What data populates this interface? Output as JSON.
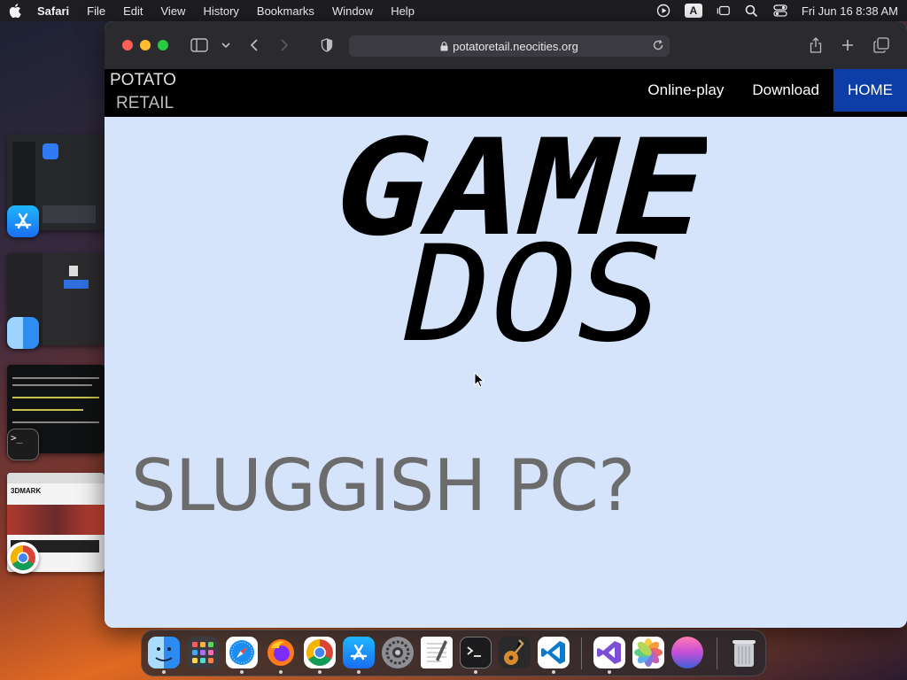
{
  "menubar": {
    "app_name": "Safari",
    "items": [
      "File",
      "Edit",
      "View",
      "History",
      "Bookmarks",
      "Window",
      "Help"
    ],
    "input_badge": "A",
    "clock": "Fri Jun 16  8:38 AM"
  },
  "browser": {
    "url": "potatoretail.neocities.org"
  },
  "site": {
    "logo_line1": "POTATO",
    "logo_line2": "RETAIL",
    "nav": [
      "Online-play",
      "Download",
      "HOME"
    ],
    "hero_line1": "GAME",
    "hero_line2": "DOS",
    "tagline": "SLUGGISH PC?"
  },
  "stage_manager": {
    "thumb_label": "3DMARK"
  },
  "dock": {
    "apps": [
      "finder-icon",
      "launchpad-icon",
      "safari-icon",
      "firefox-icon",
      "chrome-icon",
      "app-store-icon",
      "system-settings-icon",
      "textedit-icon",
      "terminal-icon",
      "garageband-icon",
      "vscode-icon",
      "visual-studio-icon",
      "photos-icon",
      "macos-sonoma-icon",
      "trash-icon"
    ]
  }
}
